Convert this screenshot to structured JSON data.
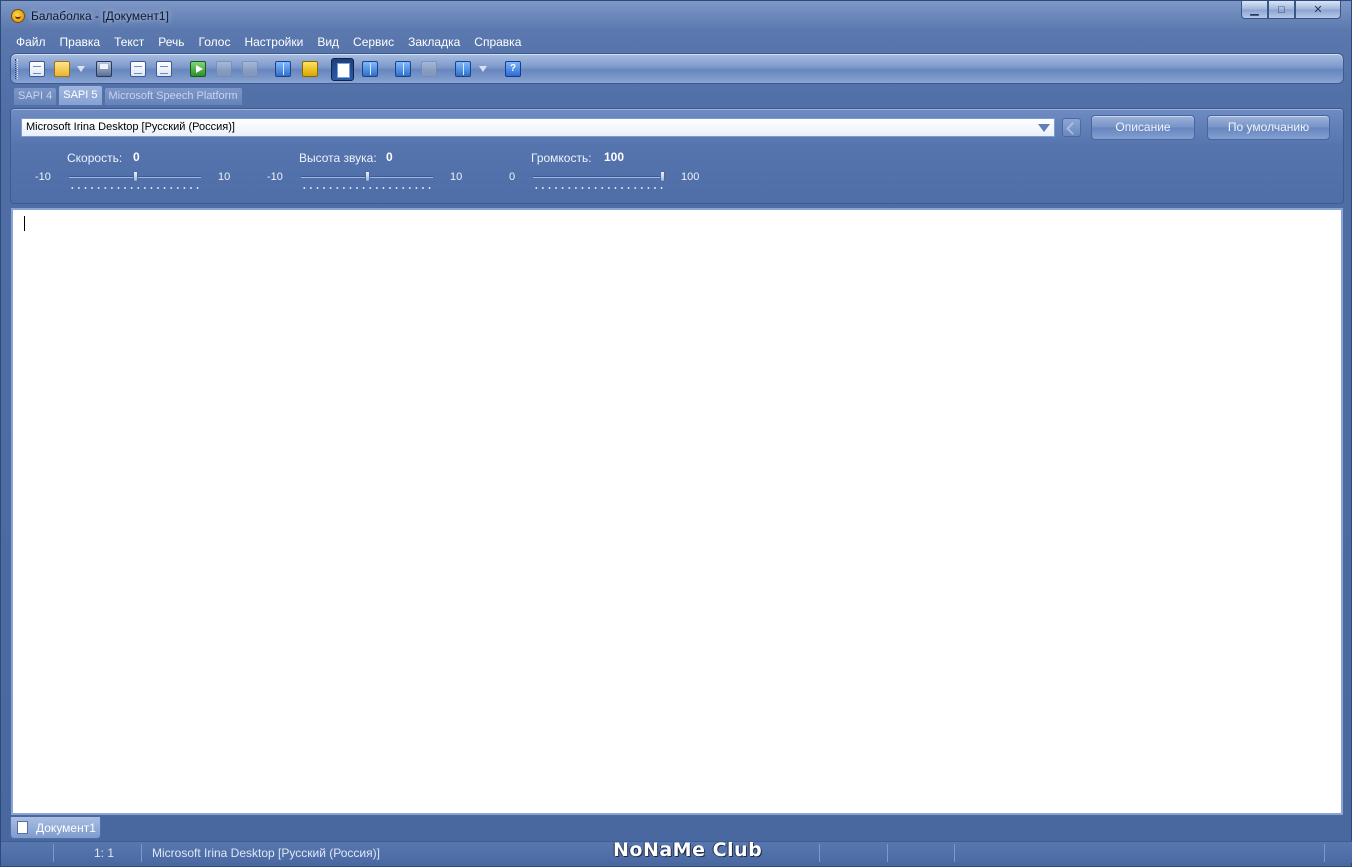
{
  "window": {
    "title": "Балаболка - [Документ1]",
    "controls": {
      "minimize": "▁",
      "maximize": "□",
      "close": "✕"
    }
  },
  "menu": [
    "Файл",
    "Правка",
    "Текст",
    "Речь",
    "Голос",
    "Настройки",
    "Вид",
    "Сервис",
    "Закладка",
    "Справка"
  ],
  "toolbar": {
    "icons": [
      "new-document-icon",
      "open-folder-icon",
      "save-icon",
      "convert-icon",
      "convert-clipboard-icon",
      "play-icon",
      "pause-icon",
      "stop-icon",
      "read-clipboard-icon",
      "bookmark-icon",
      "text-editor-icon",
      "dictionary-icon",
      "split-icon",
      "merge-icon",
      "compare-icon",
      "help-icon"
    ],
    "help_label": "?"
  },
  "engine_tabs": [
    "SAPI 4",
    "SAPI 5",
    "Microsoft Speech Platform"
  ],
  "voice": {
    "selected": "Microsoft Irina Desktop [Русский (Россия)]",
    "about_button": "Описание",
    "default_button": "По умолчанию"
  },
  "sliders": {
    "rate": {
      "label": "Скорость:",
      "value": "0",
      "min": "-10",
      "max": "10",
      "fraction": 0.5
    },
    "pitch": {
      "label": "Высота звука:",
      "value": "0",
      "min": "-10",
      "max": "10",
      "fraction": 0.5
    },
    "volume": {
      "label": "Громкость:",
      "value": "100",
      "min": "0",
      "max": "100",
      "fraction": 1.0
    }
  },
  "document_tabs": [
    "Документ1"
  ],
  "status": {
    "position": "1:   1",
    "voice": "Microsoft Irina Desktop [Русский (Россия)]"
  },
  "watermark": "NoNaMe Club",
  "colors": {
    "accent": "#4f6ea6",
    "editor_bg": "#ffffff"
  }
}
